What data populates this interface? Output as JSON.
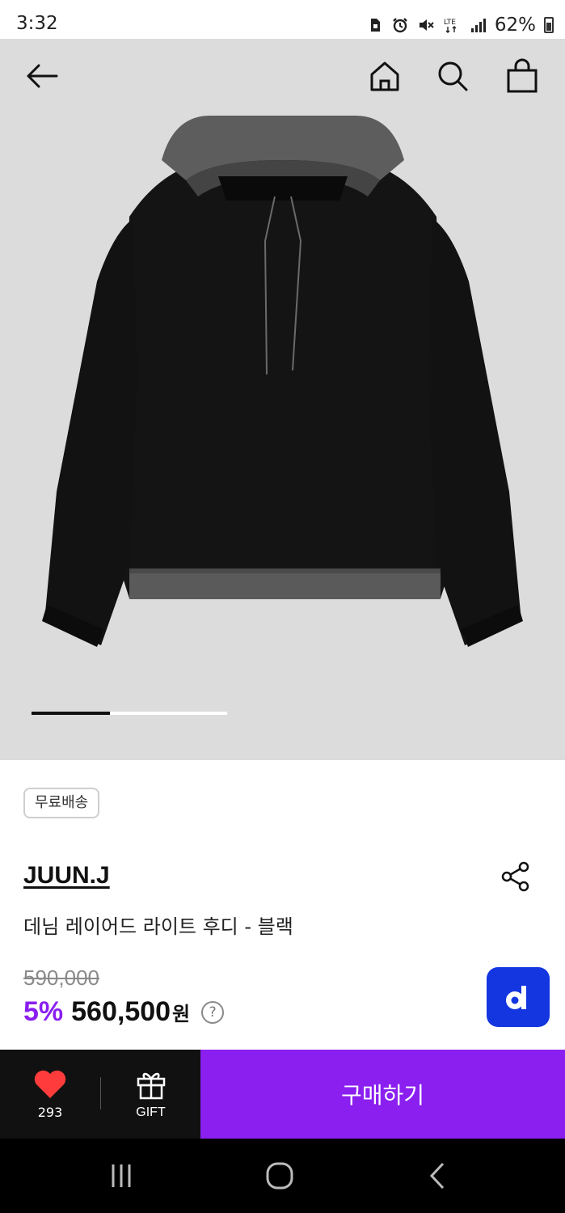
{
  "status_bar": {
    "time": "3:32",
    "battery_text": "62%",
    "network": "LTE",
    "icons": [
      "sim-card-icon",
      "alarm-icon",
      "mute-icon",
      "lte-icon",
      "signal-icon",
      "battery-icon"
    ]
  },
  "top_nav": {
    "icons": [
      "back-arrow-icon",
      "home-icon",
      "search-icon",
      "shopping-bag-icon"
    ]
  },
  "gallery": {
    "progress": 0.4
  },
  "product": {
    "badge": "무료배송",
    "brand": "JUUN.J",
    "title": "데님 레이어드 라이트 후디 - 블랙",
    "original_price": "590,000",
    "discount": "5%",
    "price": "560,500",
    "currency": "원",
    "help_symbol": "?"
  },
  "action_bar": {
    "like_count": "293",
    "gift_label": "GIFT",
    "buy_label": "구매하기"
  },
  "colors": {
    "accent": "#8a1ff0",
    "dbutton": "#1436e0",
    "like": "#ff3b3b",
    "bar": "#111111"
  }
}
